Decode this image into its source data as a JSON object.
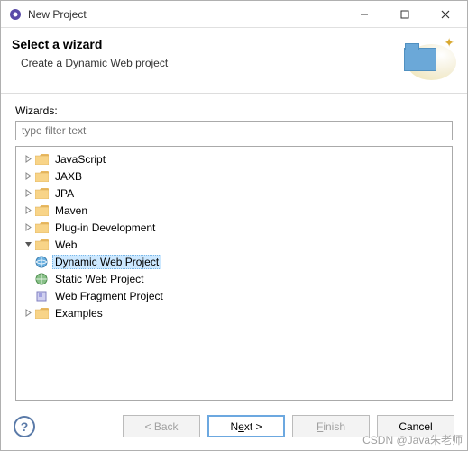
{
  "window": {
    "title": "New Project"
  },
  "banner": {
    "heading": "Select a wizard",
    "sub": "Create a Dynamic Web project"
  },
  "wizards_label": "Wizards:",
  "filter_placeholder": "type filter text",
  "tree": {
    "items": [
      {
        "label": "JavaScript",
        "expanded": false,
        "level": 1
      },
      {
        "label": "JAXB",
        "expanded": false,
        "level": 1
      },
      {
        "label": "JPA",
        "expanded": false,
        "level": 1
      },
      {
        "label": "Maven",
        "expanded": false,
        "level": 1
      },
      {
        "label": "Plug-in Development",
        "expanded": false,
        "level": 1
      },
      {
        "label": "Web",
        "expanded": true,
        "level": 1
      },
      {
        "label": "Dynamic Web Project",
        "leaf": true,
        "level": 2,
        "selected": true,
        "icon": "globe"
      },
      {
        "label": "Static Web Project",
        "leaf": true,
        "level": 2,
        "icon": "globe-static"
      },
      {
        "label": "Web Fragment Project",
        "leaf": true,
        "level": 2,
        "icon": "fragment"
      },
      {
        "label": "Examples",
        "expanded": false,
        "level": 1
      }
    ]
  },
  "buttons": {
    "back": "< Back",
    "next_pre": "N",
    "next_u": "e",
    "next_post": "xt >",
    "finish_pre": "",
    "finish_u": "F",
    "finish_post": "inish",
    "cancel": "Cancel"
  },
  "watermark": "CSDN @Java朱老师"
}
